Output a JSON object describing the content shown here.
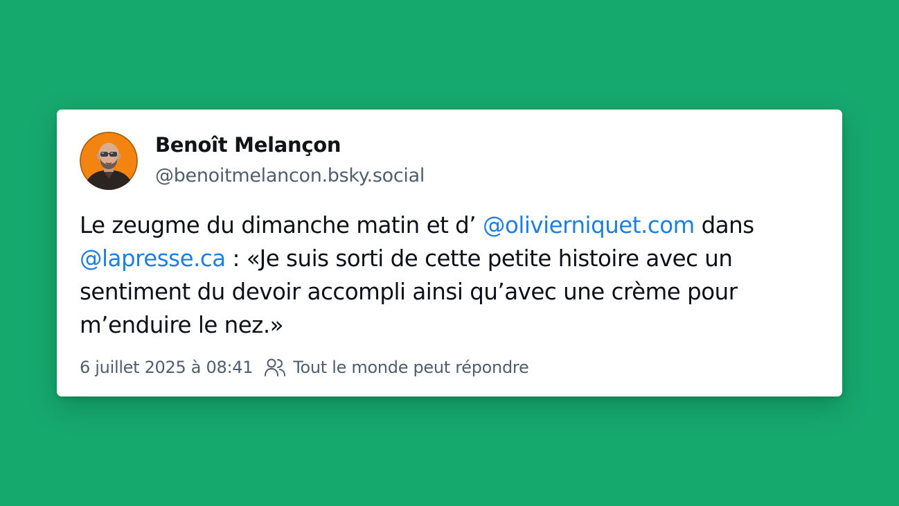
{
  "post": {
    "author": {
      "display_name": "Benoît Melançon",
      "handle": "@benoitmelancon.bsky.social",
      "avatar_icon": "bald-man-with-sunglasses-avatar-icon"
    },
    "text_segments": [
      {
        "type": "text",
        "value": "Le zeugme du dimanche matin et d’ "
      },
      {
        "type": "mention",
        "value": "@olivierniquet.com"
      },
      {
        "type": "text",
        "value": " dans "
      },
      {
        "type": "mention",
        "value": "@lapresse.ca"
      },
      {
        "type": "text",
        "value": " : «Je suis sorti de cette petite histoire avec un sentiment du devoir accompli ainsi qu’avec une crème pour m’enduire le nez.»"
      }
    ],
    "timestamp": "6 juillet 2025 à 08:41",
    "reply_icon": "people-icon",
    "reply_setting": "Tout le monde peut répondre"
  },
  "colors": {
    "background": "#16a96e",
    "card": "#ffffff",
    "mention": "#1d7fe6",
    "muted_text": "#4f5d6e",
    "avatar_background": "#f2840f"
  }
}
